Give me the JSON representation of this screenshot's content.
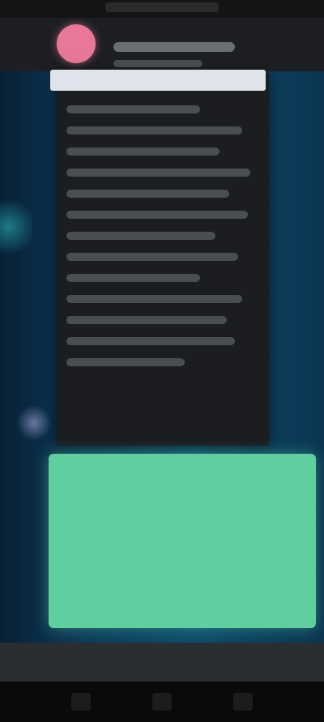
{
  "colors": {
    "avatar": "#e9779a",
    "background_blue": "#0e4c6b",
    "card_dark": "#1b1d20",
    "banner_light": "#dfe4ea",
    "green_box": "#5fcfa0",
    "header_dark": "#1d1f22",
    "nav_black": "#0a0a0a"
  },
  "icons": {
    "avatar": "avatar-icon",
    "nav_back": "back-icon",
    "nav_home": "home-icon",
    "nav_recents": "recents-icon"
  },
  "note": ""
}
